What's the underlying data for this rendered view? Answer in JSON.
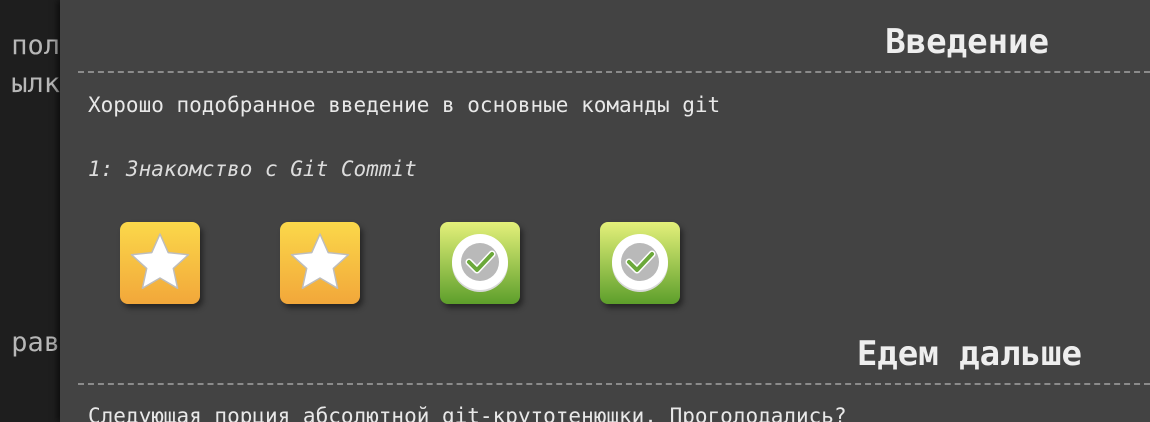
{
  "sidebar": {
    "fragments": [
      "пол",
      "ылк",
      "рав"
    ]
  },
  "sections": {
    "intro": {
      "title": "Введение",
      "description": "Хорошо подобранное введение в основные команды git",
      "level_name": "1: Знакомство с Git Commit",
      "badges": [
        {
          "type": "star",
          "icon": "star-icon"
        },
        {
          "type": "star",
          "icon": "star-icon"
        },
        {
          "type": "check",
          "icon": "checkmark-icon"
        },
        {
          "type": "check",
          "icon": "checkmark-icon"
        }
      ]
    },
    "next": {
      "title": "Едем дальше",
      "description": "Следующая порция абсолютной git-крутотенюшки. Проголодались?"
    }
  },
  "colors": {
    "panel_bg": "#434343",
    "star_badge_top": "#fbd84a",
    "star_badge_bottom": "#f2a73a",
    "check_badge_top": "#e4f07a",
    "check_badge_bottom": "#5d9f2b"
  }
}
